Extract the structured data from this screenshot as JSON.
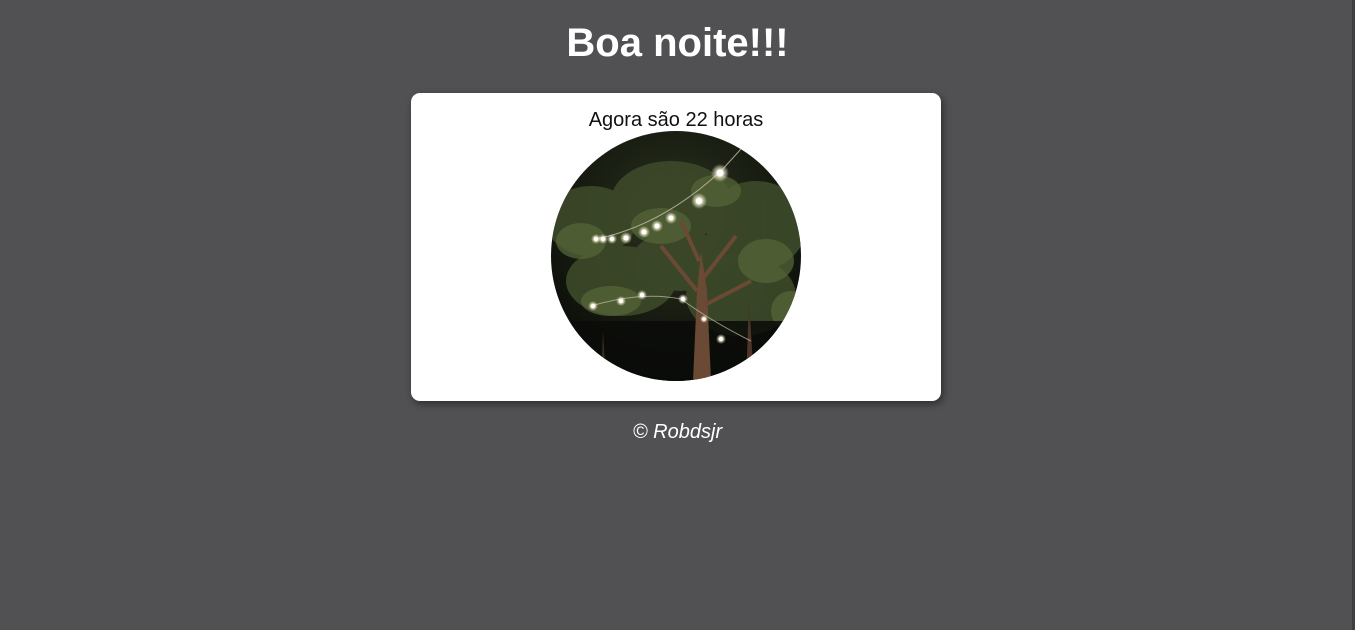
{
  "greeting": "Boa noite!!!",
  "card": {
    "time_text": "Agora são 22 horas",
    "photo_icon": "night-trees-string-lights-image"
  },
  "footer": {
    "copyright": "© Robdsjr"
  },
  "colors": {
    "background": "#515154",
    "card": "#ffffff",
    "heading": "#ffffff"
  }
}
